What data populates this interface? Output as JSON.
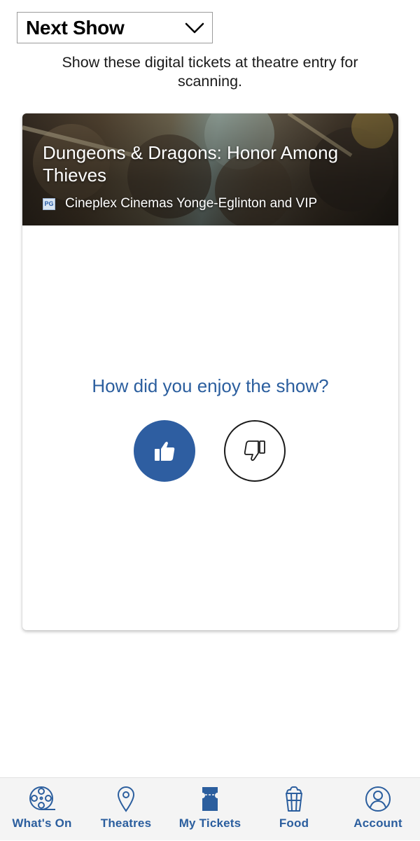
{
  "header": {
    "dropdown_label": "Next Show",
    "subtitle": "Show these digital tickets at theatre entry for scanning."
  },
  "ticket": {
    "movie_title": "Dungeons & Dragons: Honor Among Thieves",
    "rating": "PG",
    "theatre": "Cineplex Cinemas Yonge-Eglinton and VIP",
    "question": "How did you enjoy the show?"
  },
  "tabs": [
    {
      "label": "What's On",
      "icon": "film-reel-icon"
    },
    {
      "label": "Theatres",
      "icon": "location-pin-icon"
    },
    {
      "label": "My Tickets",
      "icon": "ticket-icon"
    },
    {
      "label": "Food",
      "icon": "popcorn-icon"
    },
    {
      "label": "Account",
      "icon": "user-icon"
    }
  ],
  "colors": {
    "accent": "#2e5ea1",
    "tab_label": "#2b5e9e",
    "tab_bar_bg": "#f4f4f4"
  }
}
